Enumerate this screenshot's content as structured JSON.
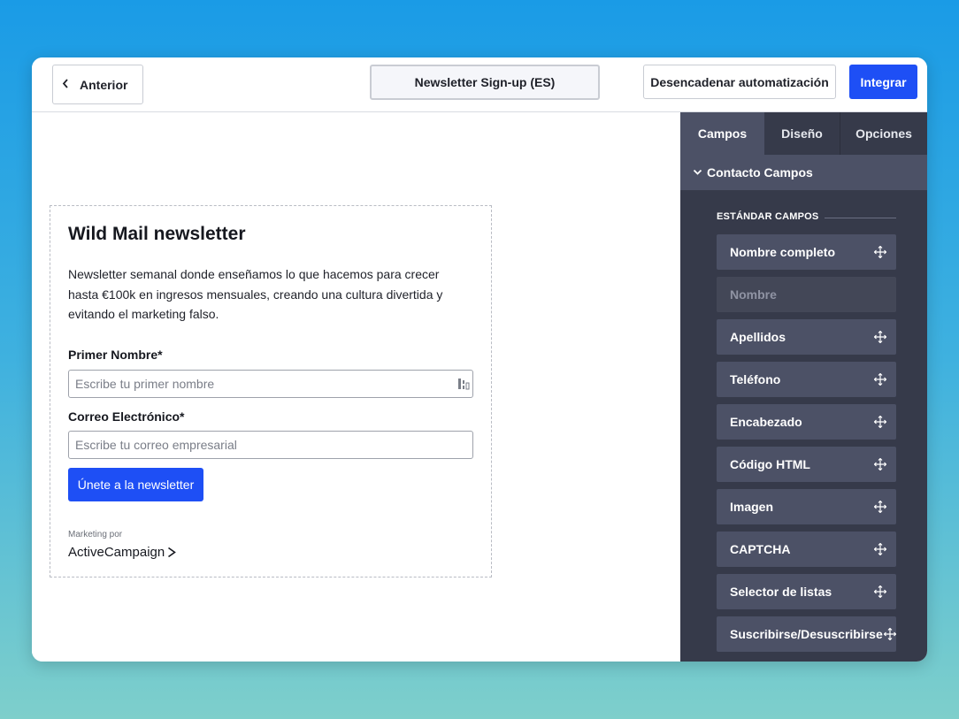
{
  "toolbar": {
    "back_label": "Anterior",
    "form_name": "Newsletter Sign-up (ES)",
    "trigger_label": "Desencadenar automatización",
    "integrate_label": "Integrar"
  },
  "form": {
    "title": "Wild Mail newsletter",
    "description": "Newsletter semanal donde enseñamos lo que hacemos para crecer hasta €100k en ingresos mensuales, creando una cultura divertida y evitando el marketing falso.",
    "first_name_label": "Primer Nombre*",
    "first_name_placeholder": "Escribe tu primer nombre",
    "email_label": "Correo Electrónico*",
    "email_placeholder": "Escribe tu correo empresarial",
    "submit_label": "Únete a la newsletter",
    "marketing_by": "Marketing por",
    "brand": "ActiveCampaign"
  },
  "sidebar": {
    "tabs": [
      "Campos",
      "Diseño",
      "Opciones"
    ],
    "active_tab": "Campos",
    "section_title": "Contacto Campos",
    "group_title": "ESTÁNDAR CAMPOS",
    "fields": [
      {
        "label": "Nombre completo",
        "enabled": true
      },
      {
        "label": "Nombre",
        "enabled": false
      },
      {
        "label": "Apellidos",
        "enabled": true
      },
      {
        "label": "Teléfono",
        "enabled": true
      },
      {
        "label": "Encabezado",
        "enabled": true
      },
      {
        "label": "Código HTML",
        "enabled": true
      },
      {
        "label": "Imagen",
        "enabled": true
      },
      {
        "label": "CAPTCHA",
        "enabled": true
      },
      {
        "label": "Selector de listas",
        "enabled": true
      },
      {
        "label": "Suscribirse/Desuscribirse",
        "enabled": true
      }
    ]
  },
  "colors": {
    "primary": "#1e4ff5",
    "sidebar_bg": "#363a4a",
    "sidebar_item": "#4c5166"
  },
  "icons": {
    "back": "chevron-left-icon",
    "section_toggle": "chevron-down-icon",
    "field_drag": "move-icon",
    "input_extension": "extension-icon",
    "brand_mark": "arrow-right-icon"
  }
}
